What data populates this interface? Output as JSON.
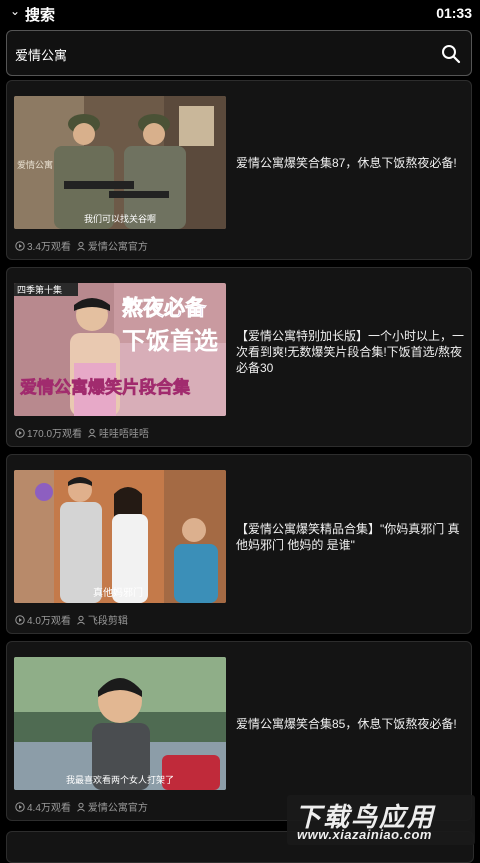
{
  "header": {
    "back_label": "搜索",
    "time": "01:33"
  },
  "search": {
    "query": "爱情公寓"
  },
  "videos": [
    {
      "title": "爱情公寓爆笑合集87，休息下饭熬夜必备!",
      "views": "3.4万观看",
      "author": "爱情公寓官方",
      "thumb_caption": "我们可以找关谷啊",
      "thumb_tag": "爱情公寓"
    },
    {
      "title": "【爱情公寓特别加长版】一个小时以上，一次看到爽!无数爆笑片段合集!下饭首选/熬夜必备30",
      "views": "170.0万观看",
      "author": "哇哇唔哇唔",
      "thumb_overlay1": "熬夜必备",
      "thumb_overlay2": "下饭首选",
      "thumb_overlay3": "爱情公寓爆笑片段合集",
      "thumb_badge": "四季第十集"
    },
    {
      "title": "【爱情公寓爆笑精品合集】\"你妈真邪门 真他妈邪门 他妈的 是谁\"",
      "views": "4.0万观看",
      "author": "飞段剪辑",
      "thumb_caption": "真他妈邪门"
    },
    {
      "title": "爱情公寓爆笑合集85，休息下饭熬夜必备!",
      "views": "4.4万观看",
      "author": "爱情公寓官方",
      "thumb_caption": "我最喜欢看两个女人打架了"
    }
  ],
  "watermark": {
    "name": "下载鸟应用",
    "url": "www.xiazainiao.com"
  }
}
